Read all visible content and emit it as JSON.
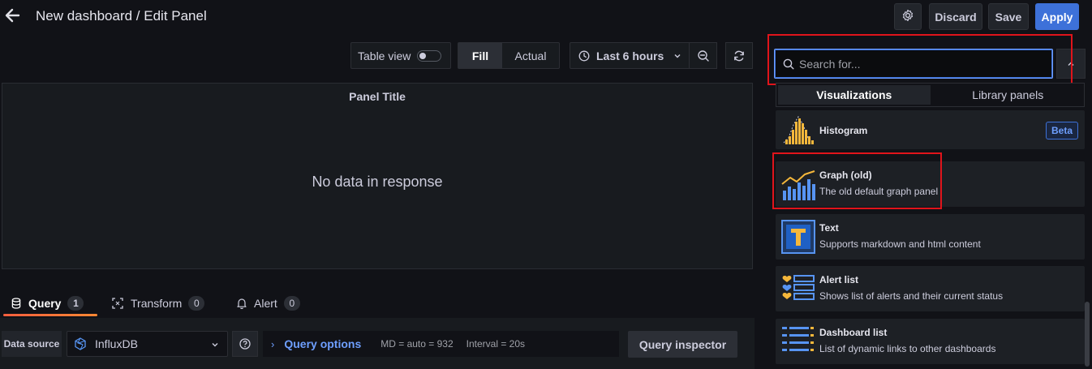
{
  "header": {
    "title": "New dashboard / Edit Panel",
    "discard_label": "Discard",
    "save_label": "Save",
    "apply_label": "Apply"
  },
  "toolbar": {
    "table_view_label": "Table view",
    "table_view_on": false,
    "fill_label": "Fill",
    "actual_label": "Actual",
    "time_range_label": "Last 6 hours"
  },
  "panel": {
    "title": "Panel Title",
    "empty_message": "No data in response"
  },
  "editor_tabs": [
    {
      "label": "Query",
      "count": "1"
    },
    {
      "label": "Transform",
      "count": "0"
    },
    {
      "label": "Alert",
      "count": "0"
    }
  ],
  "query_row": {
    "data_source_label": "Data source",
    "data_source_value": "InfluxDB",
    "query_options_label": "Query options",
    "md_text": "MD = auto = 932",
    "interval_text": "Interval = 20s",
    "inspector_label": "Query inspector"
  },
  "viz_picker": {
    "search_placeholder": "Search for...",
    "tabs": [
      "Visualizations",
      "Library panels"
    ],
    "items": [
      {
        "name": "Histogram",
        "description": "",
        "badge": "Beta"
      },
      {
        "name": "Graph (old)",
        "description": "The old default graph panel"
      },
      {
        "name": "Text",
        "description": "Supports markdown and html content"
      },
      {
        "name": "Alert list",
        "description": "Shows list of alerts and their current status"
      },
      {
        "name": "Dashboard list",
        "description": "List of dynamic links to other dashboards"
      }
    ]
  },
  "colors": {
    "accent_blue": "#3d71d9",
    "highlight_red": "#e0141b",
    "tab_underline": "#f55f3e",
    "icon_orange": "#f5b73b",
    "icon_blue": "#5794f2"
  }
}
